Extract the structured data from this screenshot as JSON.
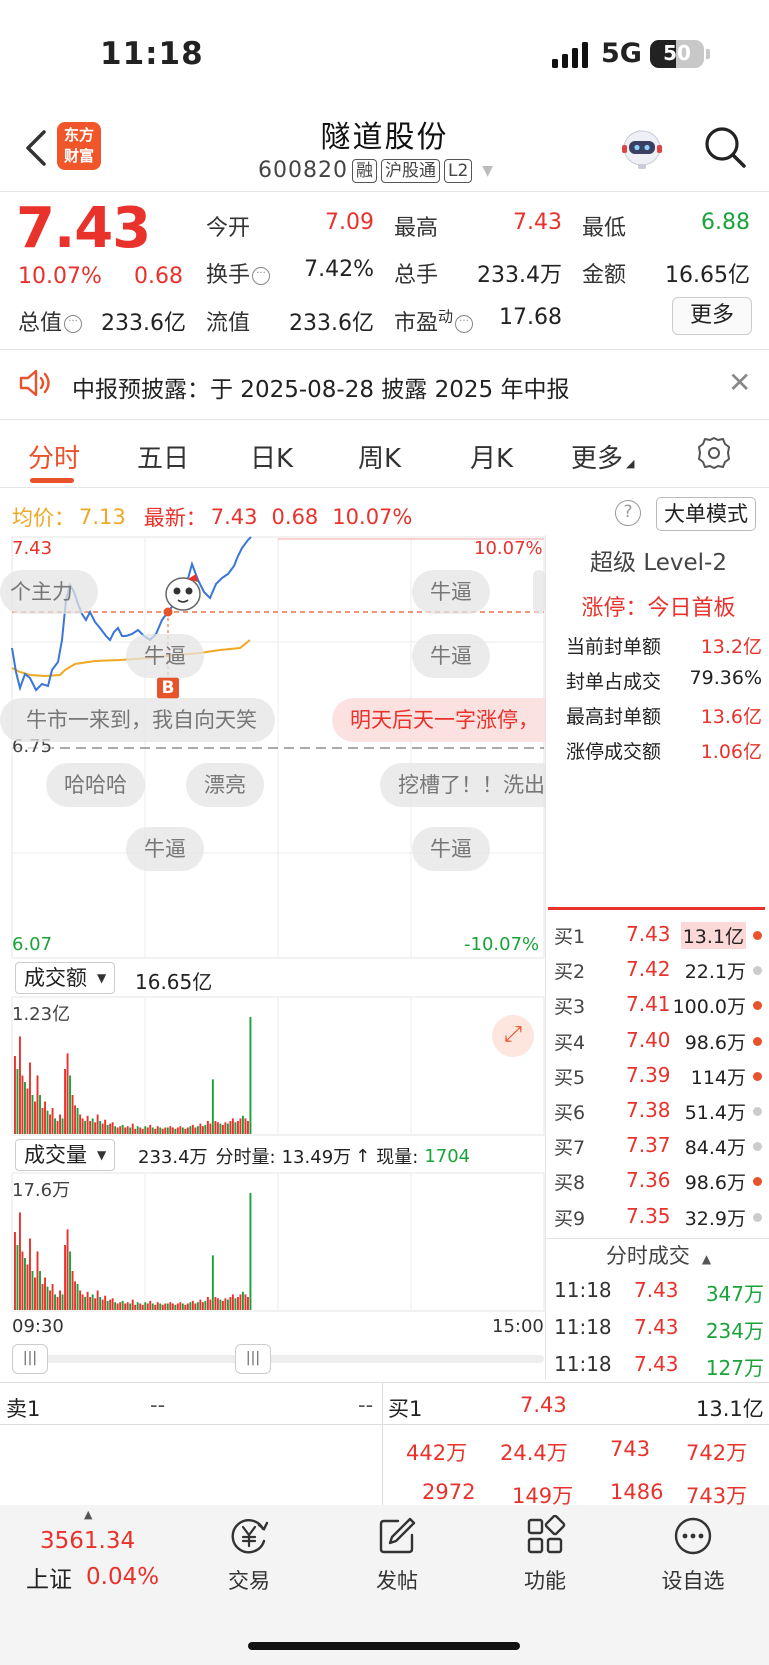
{
  "status_bar": {
    "time": "11:18",
    "network": "5G",
    "battery": "50"
  },
  "header": {
    "logo_line1": "东方",
    "logo_line2": "财富",
    "stock_name": "隧道股份",
    "stock_code": "600820",
    "tags": [
      "融",
      "沪股通",
      "L2"
    ]
  },
  "quote": {
    "price": "7.43",
    "change_pct": "10.07%",
    "change": "0.68",
    "open_label": "今开",
    "open": "7.09",
    "high_label": "最高",
    "high": "7.43",
    "low_label": "最低",
    "low": "6.88",
    "turnover_label": "换手",
    "turnover": "7.42%",
    "volume_label": "总手",
    "volume": "233.4万",
    "amount_label": "金额",
    "amount": "16.65亿",
    "mktcap_label": "总值",
    "mktcap": "233.6亿",
    "float_label": "流值",
    "float_cap": "233.6亿",
    "pe_label": "市盈",
    "pe_sup": "动",
    "pe": "17.68",
    "more_button": "更多"
  },
  "notice": {
    "text": "中报预披露：于 2025-08-28 披露 2025 年中报"
  },
  "tabs": [
    "分时",
    "五日",
    "日K",
    "周K",
    "月K",
    "更多"
  ],
  "avg_row": {
    "avg_label": "均价：",
    "avg": "7.13",
    "latest_label": "最新：",
    "latest": "7.43",
    "change": "0.68",
    "change_pct": "10.07%",
    "big_mode": "大单模式"
  },
  "chart": {
    "y_top": "7.43",
    "y_top_pct": "10.07%",
    "y_mid": "6.75",
    "y_bottom": "6.07",
    "y_bottom_pct": "-10.07%",
    "marker": "B",
    "amount_dropdown": "成交额",
    "amount_total": "16.65亿",
    "amount_max": "1.23亿",
    "volume_dropdown": "成交量",
    "volume_total": "233.4万",
    "volume_period_label": "分时量:",
    "volume_period": "13.49万",
    "volume_now_label": "现量:",
    "volume_now": "1704",
    "volume_max": "17.6万",
    "time_start": "09:30",
    "time_end": "15:00"
  },
  "bubbles": [
    "个主力",
    "牛逼",
    "牛逼",
    "牛逼",
    "牛市一来到，我自向天笑",
    "明天后天一字涨停，",
    "哈哈哈",
    "漂亮",
    "挖槽了！！洗出",
    "牛逼",
    "牛逼"
  ],
  "level2": {
    "title": "超级 Level-2",
    "limit_text": "涨停：今日首板",
    "rows": [
      {
        "label": "当前封单额",
        "value": "13.2亿"
      },
      {
        "label": "封单占成交",
        "value": "79.36%"
      },
      {
        "label": "最高封单额",
        "value": "13.6亿"
      },
      {
        "label": "涨停成交额",
        "value": "1.06亿"
      }
    ]
  },
  "order_book": [
    {
      "label": "买1",
      "price": "7.43",
      "vol": "13.1亿",
      "dot": "#e9532b",
      "hl": true
    },
    {
      "label": "买2",
      "price": "7.42",
      "vol": "22.1万",
      "dot": "#cccccc"
    },
    {
      "label": "买3",
      "price": "7.41",
      "vol": "100.0万",
      "dot": "#e9532b"
    },
    {
      "label": "买4",
      "price": "7.40",
      "vol": "98.6万",
      "dot": "#e9532b"
    },
    {
      "label": "买5",
      "price": "7.39",
      "vol": "114万",
      "dot": "#e9532b"
    },
    {
      "label": "买6",
      "price": "7.38",
      "vol": "51.4万",
      "dot": "#cccccc"
    },
    {
      "label": "买7",
      "price": "7.37",
      "vol": "84.4万",
      "dot": "#cccccc"
    },
    {
      "label": "买8",
      "price": "7.36",
      "vol": "98.6万",
      "dot": "#e9532b"
    },
    {
      "label": "买9",
      "price": "7.35",
      "vol": "32.9万",
      "dot": "#cccccc"
    }
  ],
  "trades": {
    "title": "分时成交",
    "rows": [
      {
        "time": "11:18",
        "price": "7.43",
        "vol": "347万"
      },
      {
        "time": "11:18",
        "price": "7.43",
        "vol": "234万"
      },
      {
        "time": "11:18",
        "price": "7.43",
        "vol": "127万"
      }
    ]
  },
  "lower_book": {
    "sell_label": "卖1",
    "sell_price": "--",
    "sell_vol": "--",
    "buy_label": "买1",
    "buy_price": "7.43",
    "buy_vol": "13.1亿",
    "row2": [
      "442万",
      "24.4万",
      "743",
      "742万"
    ],
    "row3": [
      "2972",
      "149万",
      "1486",
      "743万"
    ]
  },
  "bottom_nav": {
    "index_value": "3561.34",
    "index_name": "上证",
    "index_pct": "0.04%",
    "items": [
      "交易",
      "发帖",
      "功能",
      "设自选"
    ]
  },
  "colors": {
    "up": "#e9322b",
    "down": "#1aa33a",
    "accent": "#e9532b",
    "avg_line": "#f0a824",
    "price_line": "#3a76d8"
  }
}
